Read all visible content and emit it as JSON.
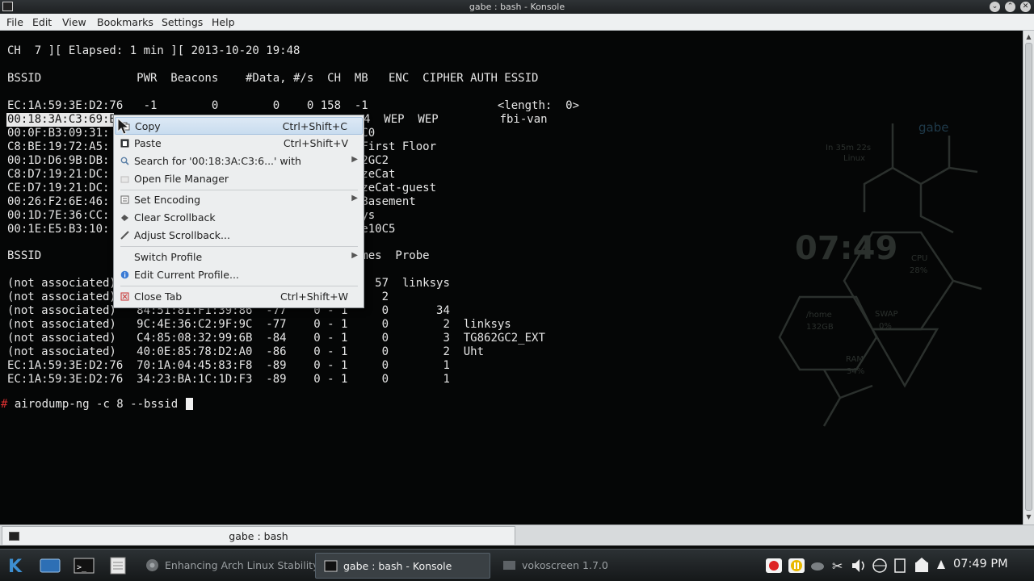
{
  "window": {
    "title": "gabe : bash - Konsole"
  },
  "menubar": {
    "items": [
      "File",
      "Edit",
      "View",
      "Bookmarks",
      "Settings",
      "Help"
    ]
  },
  "terminal": {
    "lines": [
      "CH  7 ][ Elapsed: 1 min ][ 2013-10-20 19:48",
      "",
      "BSSID              PWR  Beacons    #Data, #/s  CH  MB   ENC  CIPHER AUTH ESSID",
      "",
      "EC:1A:59:3E:D2:76   -1        0        0    0 158  -1                   <length:  0>",
      "00:18:3A:C3:69:B             4  WEP  WEP         fbi-van",
      "00:0F:B3:09:31:             4 . WEP  WEP         USWC0",
      "C8:BE:19:72:A5:            4e. WPA2 CCMP   PSK  Uht First Floor",
      "00:1D:D6:9B:DB:            4e. WPA2 CCMP   PSK  TG862GC2",
      "C8:D7:19:21:DC:            4e. WPA2 CCMP   PSK  BronzeCat",
      "CE:D7:19:21:DC:            4e. OPN              BronzeCat-guest",
      "00:26:F2:6E:46:            4e. WPA2 CCMP   PSK  Uht Basement",
      "00:1D:7E:36:CC:            4  WPA  TKIP   PSK  linksys",
      "00:1E:E5:B3:10:            4e. WPA  TKIP   PSK  @Home10C5",
      "",
      "BSSID                                    Lost    Frames  Probe",
      "",
      "(not associated)                              0       57  linksys",
      "(not associated)                              0        2",
      "(not associated)   84:51:81:F1:39:86  -77    0 - 1     0       34",
      "(not associated)   9C:4E:36:C2:9F:9C  -77    0 - 1     0        2  linksys",
      "(not associated)   C4:85:08:32:99:6B  -84    0 - 1     0        3  TG862GC2_EXT",
      "(not associated)   40:0E:85:78:D2:A0  -86    0 - 1     0        2  Uht",
      "EC:1A:59:3E:D2:76  70:1A:04:45:83:F8  -89    0 - 1     0        1",
      "EC:1A:59:3E:D2:76  34:23:BA:1C:1D:F3  -89    0 - 1     0        1"
    ],
    "prompt_symbol": "#",
    "command": " airodump-ng -c 8 --bssid "
  },
  "desktop_widget": {
    "user": "gabe",
    "uptime": "In 35m 22s",
    "os": "Linux",
    "time": "07:49",
    "cpu_label": "CPU",
    "cpu_value": "28%",
    "home_label": "/home",
    "home_value": "132GB",
    "swap_label": "SWAP",
    "swap_value": "0%",
    "ram_label": "RAM",
    "ram_value": "34%"
  },
  "context_menu": {
    "items": [
      {
        "label": "Copy",
        "shortcut": "Ctrl+Shift+C",
        "icon": "copy-icon"
      },
      {
        "label": "Paste",
        "shortcut": "Ctrl+Shift+V",
        "icon": "paste-icon"
      },
      {
        "label": "Search for '00:18:3A:C3:6...' with",
        "shortcut": "",
        "icon": "search-icon",
        "submenu": true
      },
      {
        "label": "Open File Manager",
        "shortcut": "",
        "icon": "folder-icon"
      },
      {
        "label": "Set Encoding",
        "shortcut": "",
        "icon": "encoding-icon",
        "submenu": true
      },
      {
        "label": "Clear Scrollback",
        "shortcut": "",
        "icon": "clear-icon"
      },
      {
        "label": "Adjust Scrollback...",
        "shortcut": "",
        "icon": "adjust-icon"
      },
      {
        "label": "Switch Profile",
        "shortcut": "",
        "icon": "",
        "submenu": true
      },
      {
        "label": "Edit Current Profile...",
        "shortcut": "",
        "icon": "info-icon"
      },
      {
        "label": "Close Tab",
        "shortcut": "Ctrl+Shift+W",
        "icon": "close-tab-icon"
      }
    ]
  },
  "tabbar": {
    "tab_label": "gabe : bash"
  },
  "taskbar": {
    "tasks": [
      {
        "label": "Enhancing Arch Linux Stability",
        "icon": "chrome-icon"
      },
      {
        "label": "gabe : bash - Konsole",
        "icon": "terminal-icon"
      },
      {
        "label": "vokoscreen 1.7.0",
        "icon": "vokoscreen-icon"
      }
    ],
    "clock": "07:49 PM"
  },
  "colors": {
    "prompt": "#d93030",
    "terminal_bg": "#050606",
    "terminal_fg": "#e6e6e6",
    "menu_highlight": "#c8dcef"
  }
}
